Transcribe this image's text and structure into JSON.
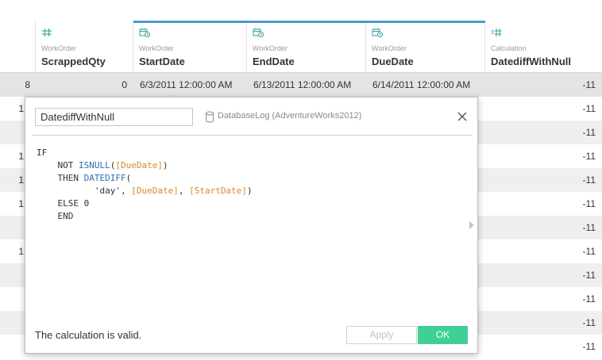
{
  "columns": [
    {
      "source": "",
      "field": "",
      "icon": "none"
    },
    {
      "source": "WorkOrder",
      "field": "ScrappedQty",
      "icon": "hash-icon"
    },
    {
      "source": "WorkOrder",
      "field": "StartDate",
      "icon": "calendar-clock-icon"
    },
    {
      "source": "WorkOrder",
      "field": "EndDate",
      "icon": "calendar-clock-icon"
    },
    {
      "source": "WorkOrder",
      "field": "DueDate",
      "icon": "calendar-clock-icon"
    },
    {
      "source": "Calculation",
      "field": "DatediffWithNull",
      "icon": "calc-hash-icon"
    }
  ],
  "rows": [
    {
      "first": "8",
      "scrapped": "0",
      "start": "6/3/2011 12:00:00 AM",
      "end": "6/13/2011 12:00:00 AM",
      "due": "6/14/2011 12:00:00 AM",
      "calc": "-11"
    },
    {
      "first": "1",
      "calc": "-11"
    },
    {
      "first": "",
      "calc": "-11"
    },
    {
      "first": "1",
      "calc": "-11"
    },
    {
      "first": "1",
      "calc": "-11"
    },
    {
      "first": "1",
      "calc": "-11"
    },
    {
      "first": "",
      "calc": "-11"
    },
    {
      "first": "1",
      "calc": "-11"
    },
    {
      "first": "",
      "calc": "-11"
    },
    {
      "first": "",
      "calc": "-11"
    },
    {
      "first": "",
      "calc": "-11"
    },
    {
      "first": "",
      "calc": "-11"
    }
  ],
  "dialog": {
    "name_value": "DatediffWithNull",
    "datasource": "DatabaseLog (AdventureWorks2012)",
    "code": {
      "if": "IF",
      "not": "NOT ",
      "isnull": "ISNULL",
      "duedate1": "[DueDate]",
      "then": "THEN ",
      "datediff": "DATEDIFF",
      "day": "'day', ",
      "duedate2": "[DueDate]",
      "startdate": "[StartDate]",
      "else": "ELSE 0",
      "end": "END"
    },
    "status": "The calculation is valid.",
    "apply_label": "Apply",
    "ok_label": "OK"
  },
  "colors": {
    "accent_green": "#3fcf97",
    "field_ref": "#d4882a",
    "function": "#2a6fb0",
    "selected_column": "#4b9ac9"
  }
}
